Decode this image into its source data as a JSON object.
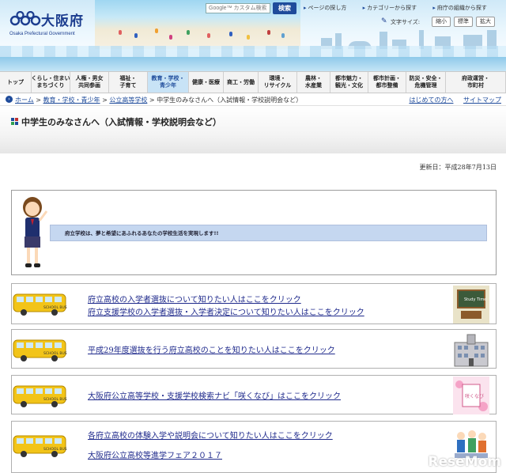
{
  "header": {
    "logo_name": "大阪府",
    "logo_sub": "Osaka Prefectural Government",
    "search_placeholder": "Google™ カスタム検索",
    "search_button": "検索",
    "top_links": [
      "ページの探し方",
      "カテゴリーから探す",
      "府庁の組織から探す"
    ],
    "font_size_label": "文字サイズ:",
    "font_size_buttons": [
      "縮小",
      "標準",
      "拡大"
    ]
  },
  "nav": {
    "items": [
      {
        "label": "トップ"
      },
      {
        "label": "くらし・住まい\nまちづくり"
      },
      {
        "label": "人権・男女\n共同参画"
      },
      {
        "label": "福祉・\n子育て"
      },
      {
        "label": "教育・学校・\n青少年",
        "active": true
      },
      {
        "label": "健康・医療"
      },
      {
        "label": "商工・労働"
      },
      {
        "label": "環境・\nリサイクル"
      },
      {
        "label": "農林・\n水産業"
      },
      {
        "label": "都市魅力・\n観光・文化"
      },
      {
        "label": "都市計画・\n都市整備"
      },
      {
        "label": "防災・安全・\n危機管理"
      },
      {
        "label": "府政運営・\n市町村"
      }
    ]
  },
  "breadcrumb": {
    "home": "ホーム",
    "sep": " > ",
    "education": "教育・学校・青少年",
    "highschool": "公立高等学校",
    "current": "中学生のみなさんへ（入試情報・学校説明会など）",
    "first_time": "はじめての方へ",
    "sitemap": "サイトマップ"
  },
  "page": {
    "title": "中学生のみなさんへ（入試情報・学校説明会など）",
    "updated": "更新日：平成28年7月13日",
    "intro_message": "府立学校は、夢と希望にあふれるあなたの学校生活を実現します!!"
  },
  "rows": [
    {
      "links": [
        "府立高校の入学者選抜について知りたい人はここをクリック",
        "府立支援学校の入学者選抜・入学者決定について知りたい人はここをクリック"
      ]
    },
    {
      "links": [
        "平成29年度選抜を行う府立高校のことを知りたい人はここをクリック"
      ]
    },
    {
      "links": [
        "大阪府公立高等学校・支援学校検索ナビ「咲くなび」はここをクリック"
      ]
    },
    {
      "links": [
        "各府立高校の体験入学や説明会について知りたい人はここをクリック",
        "大阪府公立高校等進学フェア２０１７"
      ]
    }
  ],
  "images": {
    "bus_text": "SCHOOL BUS",
    "board_text": "Study Time",
    "sakunavi_text": "咲くなび"
  },
  "watermark": "ReseMom",
  "colors": {
    "brand": "#1c3d8f",
    "nav_active": "#c8e3f6",
    "link": "#1f2a8c",
    "intro_bar": "#c5d7f0"
  }
}
